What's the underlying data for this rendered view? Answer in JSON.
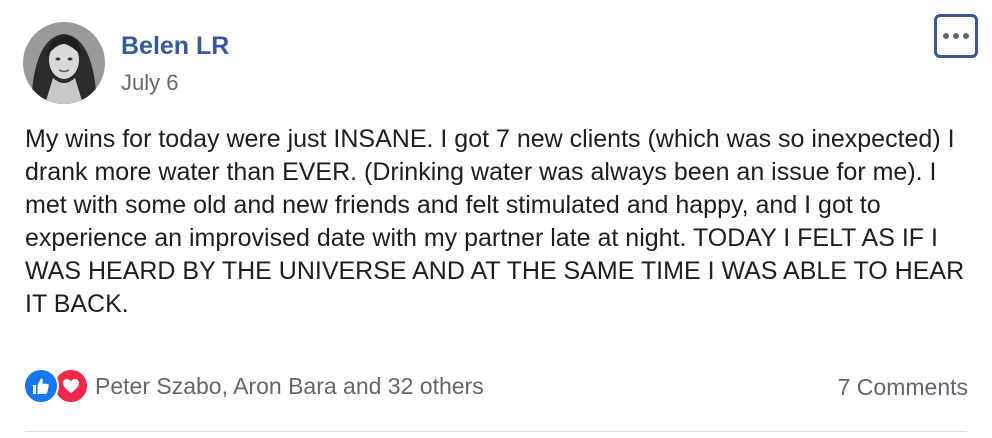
{
  "post": {
    "author": "Belen LR",
    "date": "July 6",
    "body": "My wins for today were just INSANE. I got 7 new clients (which was so inexpected) I drank more water than EVER. (Drinking water was always been an issue for me). I met with some old and new friends and felt stimulated and happy, and I got to experience an improvised date with my partner late at night. TODAY I FELT AS IF I WAS HEARD BY THE UNIVERSE AND AT THE SAME TIME I WAS ABLE TO HEAR IT BACK."
  },
  "reactions": {
    "icons": [
      "like-icon",
      "love-icon"
    ],
    "summary": "Peter Szabo, Aron Bara and 32 others"
  },
  "comments": {
    "label": "7 Comments"
  },
  "colors": {
    "author_name": "#385898",
    "meta_text": "#606770",
    "like": "#1877f2",
    "love": "#f0284a"
  }
}
